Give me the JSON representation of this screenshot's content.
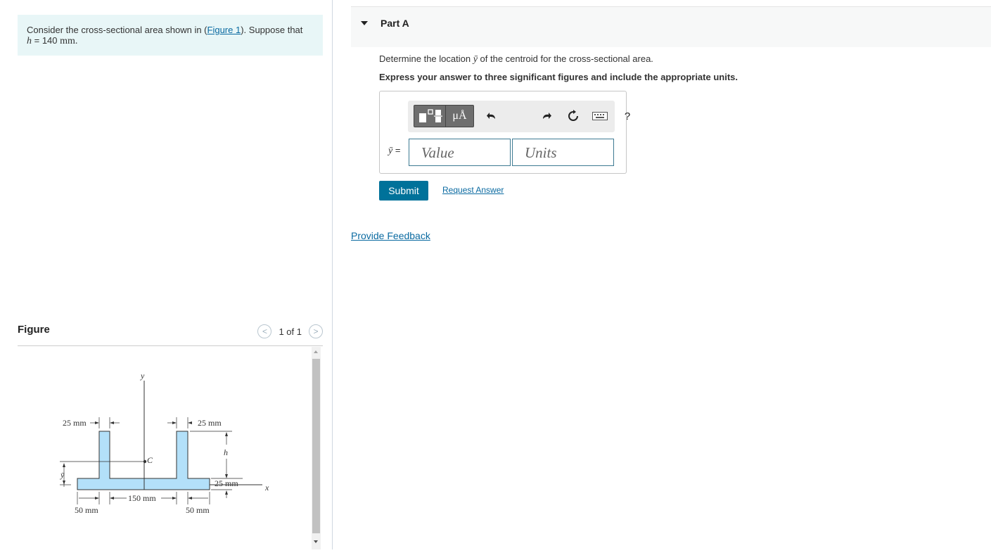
{
  "problem": {
    "text_before": "Consider the cross-sectional area shown in (",
    "figure_link": "Figure 1",
    "text_after": "). Suppose that",
    "h_var": "h",
    "h_eq": " = 140 ",
    "h_unit": "mm."
  },
  "figure": {
    "title": "Figure",
    "pager_text": "1 of 1",
    "prev_glyph": "<",
    "next_glyph": ">",
    "labels": {
      "y_axis": "y",
      "x_axis": "x",
      "centroid": "C",
      "ybar": "ȳ",
      "h": "h",
      "top_left_25": "25 mm",
      "top_right_25": "25 mm",
      "right_25": "25 mm",
      "bottom_150": "150 mm",
      "bottom_left_50": "50 mm",
      "bottom_right_50": "50 mm"
    }
  },
  "part": {
    "label": "Part A",
    "question_before": "Determine the location ",
    "question_var": "ȳ",
    "question_after": " of the centroid for the cross-sectional area.",
    "instruction": "Express your answer to three significant figures and include the appropriate units.",
    "toolbar": {
      "mu_label": "μÅ",
      "help_label": "?"
    },
    "answer": {
      "var": "ȳ",
      "eq": " =",
      "value_placeholder": "Value",
      "units_placeholder": "Units"
    },
    "submit_label": "Submit",
    "request_label": "Request Answer"
  },
  "feedback_label": "Provide Feedback",
  "colors": {
    "accent": "#00729a",
    "link": "#0a6aa1",
    "problem_bg": "#e8f6f7",
    "shape_fill": "#b3e0f9"
  }
}
